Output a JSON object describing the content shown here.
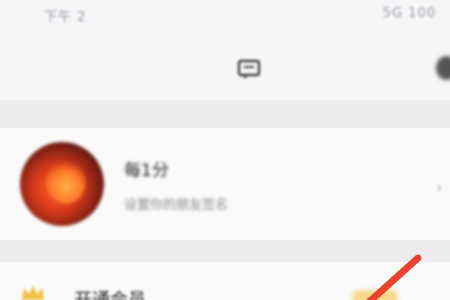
{
  "status_bar": {
    "time": "下午 2",
    "right": "5G 100"
  },
  "nav": {
    "center_icon": "message-icon",
    "right_icon": "settings-icon"
  },
  "profile": {
    "name": "每1分",
    "subtitle": "设置你的朋友签名",
    "chevron": "›"
  },
  "member": {
    "label": "开通会员",
    "icon": "crown-icon"
  },
  "colors": {
    "annotation_arrow": "#e8442e",
    "crown": "#f2c24a",
    "badge": "#f6d98a"
  }
}
